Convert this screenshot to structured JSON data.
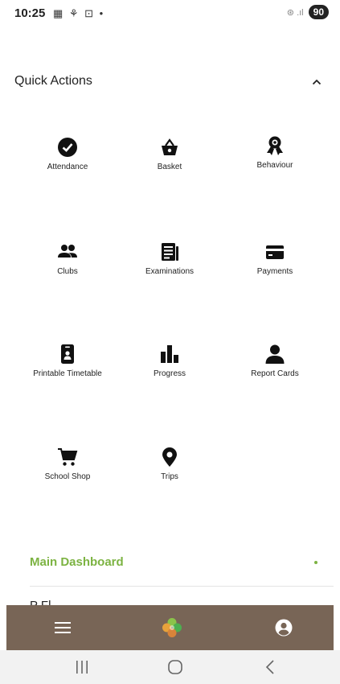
{
  "status_bar": {
    "time": "10:25",
    "left_icons": "▦ ⚘ ⊡ •",
    "signal": "⊛ .ıl",
    "battery": "90"
  },
  "quick_actions": {
    "title": "Quick Actions",
    "items": [
      {
        "label": "Attendance",
        "icon": "check-circle-icon"
      },
      {
        "label": "Basket",
        "icon": "basket-icon"
      },
      {
        "label": "Behaviour",
        "icon": "award-icon"
      },
      {
        "label": "Clubs",
        "icon": "people-icon"
      },
      {
        "label": "Examinations",
        "icon": "newspaper-icon"
      },
      {
        "label": "Payments",
        "icon": "card-icon"
      },
      {
        "label": "Printable Timetable",
        "icon": "id-card-icon"
      },
      {
        "label": "Progress",
        "icon": "bar-chart-icon"
      },
      {
        "label": "Report Cards",
        "icon": "person-icon"
      },
      {
        "label": "School Shop",
        "icon": "shopping-cart-icon"
      },
      {
        "label": "Trips",
        "icon": "map-pin-icon"
      }
    ]
  },
  "menu": {
    "main_dashboard": "Main Dashboard",
    "partial_item": "P  Fl"
  },
  "colors": {
    "accent_green": "#7cb342",
    "bottom_nav_bg": "#786556"
  }
}
